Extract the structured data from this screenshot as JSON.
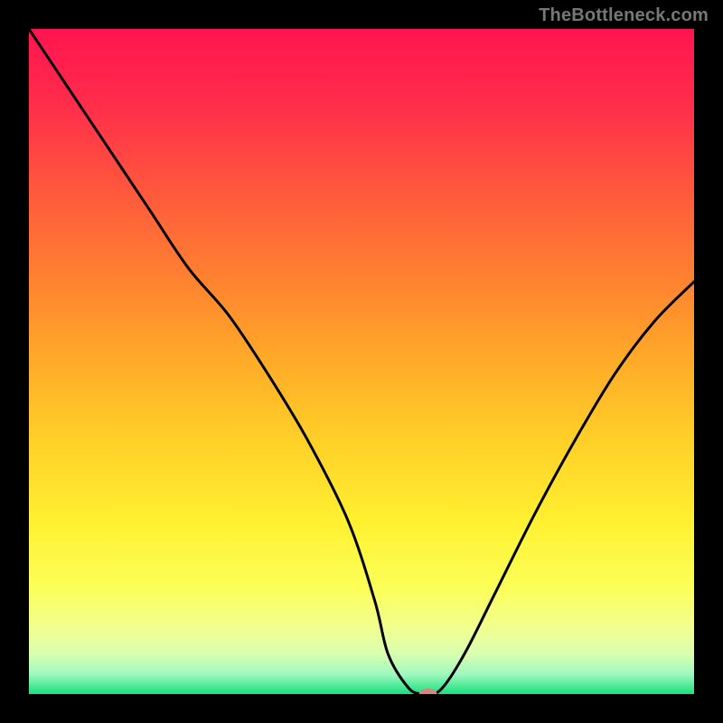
{
  "watermark": "TheBottleneck.com",
  "chart_data": {
    "type": "line",
    "title": "",
    "xlabel": "",
    "ylabel": "",
    "xlim": [
      0,
      100
    ],
    "ylim": [
      0,
      100
    ],
    "grid": false,
    "series": [
      {
        "name": "curve",
        "x": [
          0,
          6,
          12,
          18,
          24,
          30,
          36,
          42,
          48,
          52,
          54,
          57,
          59,
          61,
          63,
          66,
          70,
          76,
          82,
          88,
          94,
          100
        ],
        "y": [
          100,
          91,
          82,
          73,
          64,
          57,
          48,
          38,
          26,
          14,
          6,
          1,
          0,
          0,
          2,
          7,
          15,
          27,
          38,
          48,
          56,
          62
        ]
      }
    ],
    "marker": {
      "x": 60,
      "y": 0,
      "color": "#d98383",
      "rx": 10,
      "ry": 6
    },
    "background": {
      "type": "vertical-gradient",
      "stops": [
        {
          "offset": 0.0,
          "color": "#ff1450"
        },
        {
          "offset": 0.12,
          "color": "#ff2f4a"
        },
        {
          "offset": 0.25,
          "color": "#ff5a3c"
        },
        {
          "offset": 0.38,
          "color": "#ff8330"
        },
        {
          "offset": 0.5,
          "color": "#ffab28"
        },
        {
          "offset": 0.62,
          "color": "#ffd028"
        },
        {
          "offset": 0.74,
          "color": "#fff030"
        },
        {
          "offset": 0.84,
          "color": "#fbff58"
        },
        {
          "offset": 0.9,
          "color": "#f2ff90"
        },
        {
          "offset": 0.94,
          "color": "#d8ffb0"
        },
        {
          "offset": 0.97,
          "color": "#a0f8c0"
        },
        {
          "offset": 1.0,
          "color": "#18e07c"
        }
      ]
    }
  }
}
